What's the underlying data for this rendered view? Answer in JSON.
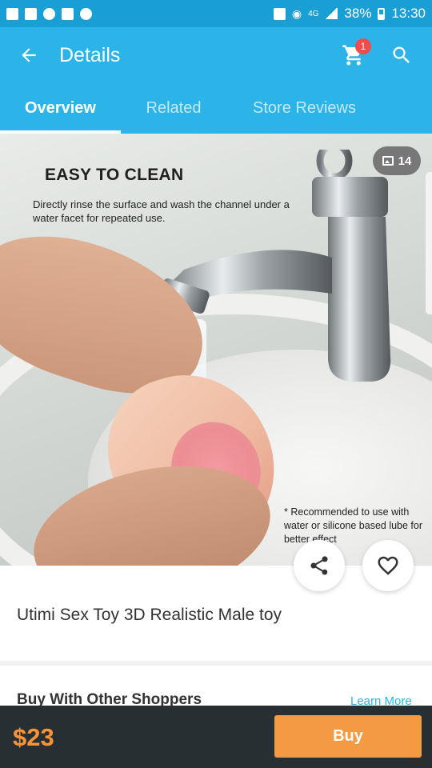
{
  "status_bar": {
    "network": "4G",
    "battery": "38%",
    "time": "13:30"
  },
  "app_bar": {
    "title": "Details",
    "cart_count": "1"
  },
  "tabs": [
    {
      "label": "Overview",
      "active": true
    },
    {
      "label": "Related",
      "active": false
    },
    {
      "label": "Store Reviews",
      "active": false
    }
  ],
  "product_image": {
    "heading": "EASY TO CLEAN",
    "subtitle": "Directly rinse the surface and wash the channel under a water facet for repeated use.",
    "note": "* Recommended to use with water or silicone based lube for better effect",
    "image_count": "14"
  },
  "product": {
    "title": "Utimi Sex Toy 3D Realistic Male toy"
  },
  "section": {
    "title": "Buy With Other Shoppers",
    "link": "Learn More"
  },
  "bottom_bar": {
    "price": "$23",
    "buy_label": "Buy"
  },
  "colors": {
    "status_bar": "#1a9fd4",
    "app_bar": "#2cb3e8",
    "badge": "#ef4d4d",
    "price": "#f7933a",
    "buy_button": "#f39a42",
    "bottom_bar": "#272f33"
  }
}
